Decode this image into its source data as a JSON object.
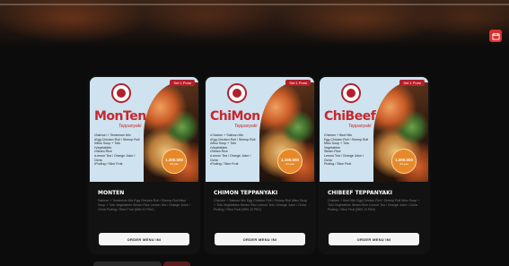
{
  "cards": [
    {
      "badge": "Set 1 Porsi",
      "brand": "MonTen",
      "brand_sub": "Teppanyaki",
      "menu_items": [
        "•Salmon + Tenderloin Mix",
        "•Egg Chicken Roll / Shrimp Roll",
        "•Miso Soup + Tofu",
        "•Vegetables",
        "•Steam Rice",
        "•Lemon Tea / Orange Juice /",
        "  Ocha",
        "•Puding / Slice Fruit"
      ],
      "price_main": "1.300.000",
      "price_sub": "/10 pax",
      "title": "MONTEN",
      "description": "Salmon + Tenderloin Mix Egg Chicken Roll / Shrimp Roll Miso Soup + Tofu Vegetables Steam Rice Lemon Tea / Orange Juice / Ocha Puding / Slice Fruit (MIN 10 PAX)",
      "button": "ORDER MENU INI"
    },
    {
      "badge": "Set 1 Porsi",
      "brand": "ChiMon",
      "brand_sub": "Teppanyaki",
      "menu_items": [
        "•Chicken + Salmon Mix",
        "•Egg Chicken Roll / Shrimp Roll",
        "•Miso Soup + Tofu",
        "•Vegetables",
        "•Steam Rice",
        "•Lemon Tea / Orange Juice /",
        "  Ocha",
        "•Puding / Slice Fruit"
      ],
      "price_main": "1.100.000",
      "price_sub": "/10 pax",
      "title": "CHIMON TEPPANYAKI",
      "description": "Chicken + Salmon Mix Egg Chicken Roll / Shrimp Roll Miso Soup + Tofu Vegetables Steam Rice Lemon Tea / Orange Juice / Ocha Puding / Slice Fruit (MIN 10 PAX)",
      "button": "ORDER MENU INI"
    },
    {
      "badge": "Set 1 Porsi",
      "brand": "ChiBeef",
      "brand_sub": "Teppanyaki",
      "menu_items": [
        "Chicken + Beef Mix",
        "Egg Chicken Roll / Shrimp Roll",
        "Miso Soup + Tofu",
        "Vegetables",
        "Steam Rice",
        "Lemon Tea / Orange Juice /",
        "Ocha",
        "Puding / Slice Fruit"
      ],
      "price_main": "1.000.000",
      "price_sub": "/10 pax",
      "title": "CHIBEEF TEPPANYAKI",
      "description": "Chicken + Beef Mix Egg Chicken Roll / Shrimp Roll Miso Soup + Tofu Vegetables Steam Rice Lemon Tea / Orange Juice / Ocha Puding / Slice Fruit (MIN 10 PAX)",
      "button": "ORDER MENU INI"
    }
  ],
  "colors": {
    "accent": "#d8322f",
    "brand_red": "#c8282d",
    "price_orange": "#e7892a"
  },
  "icons": {
    "fab": "calendar-icon"
  }
}
